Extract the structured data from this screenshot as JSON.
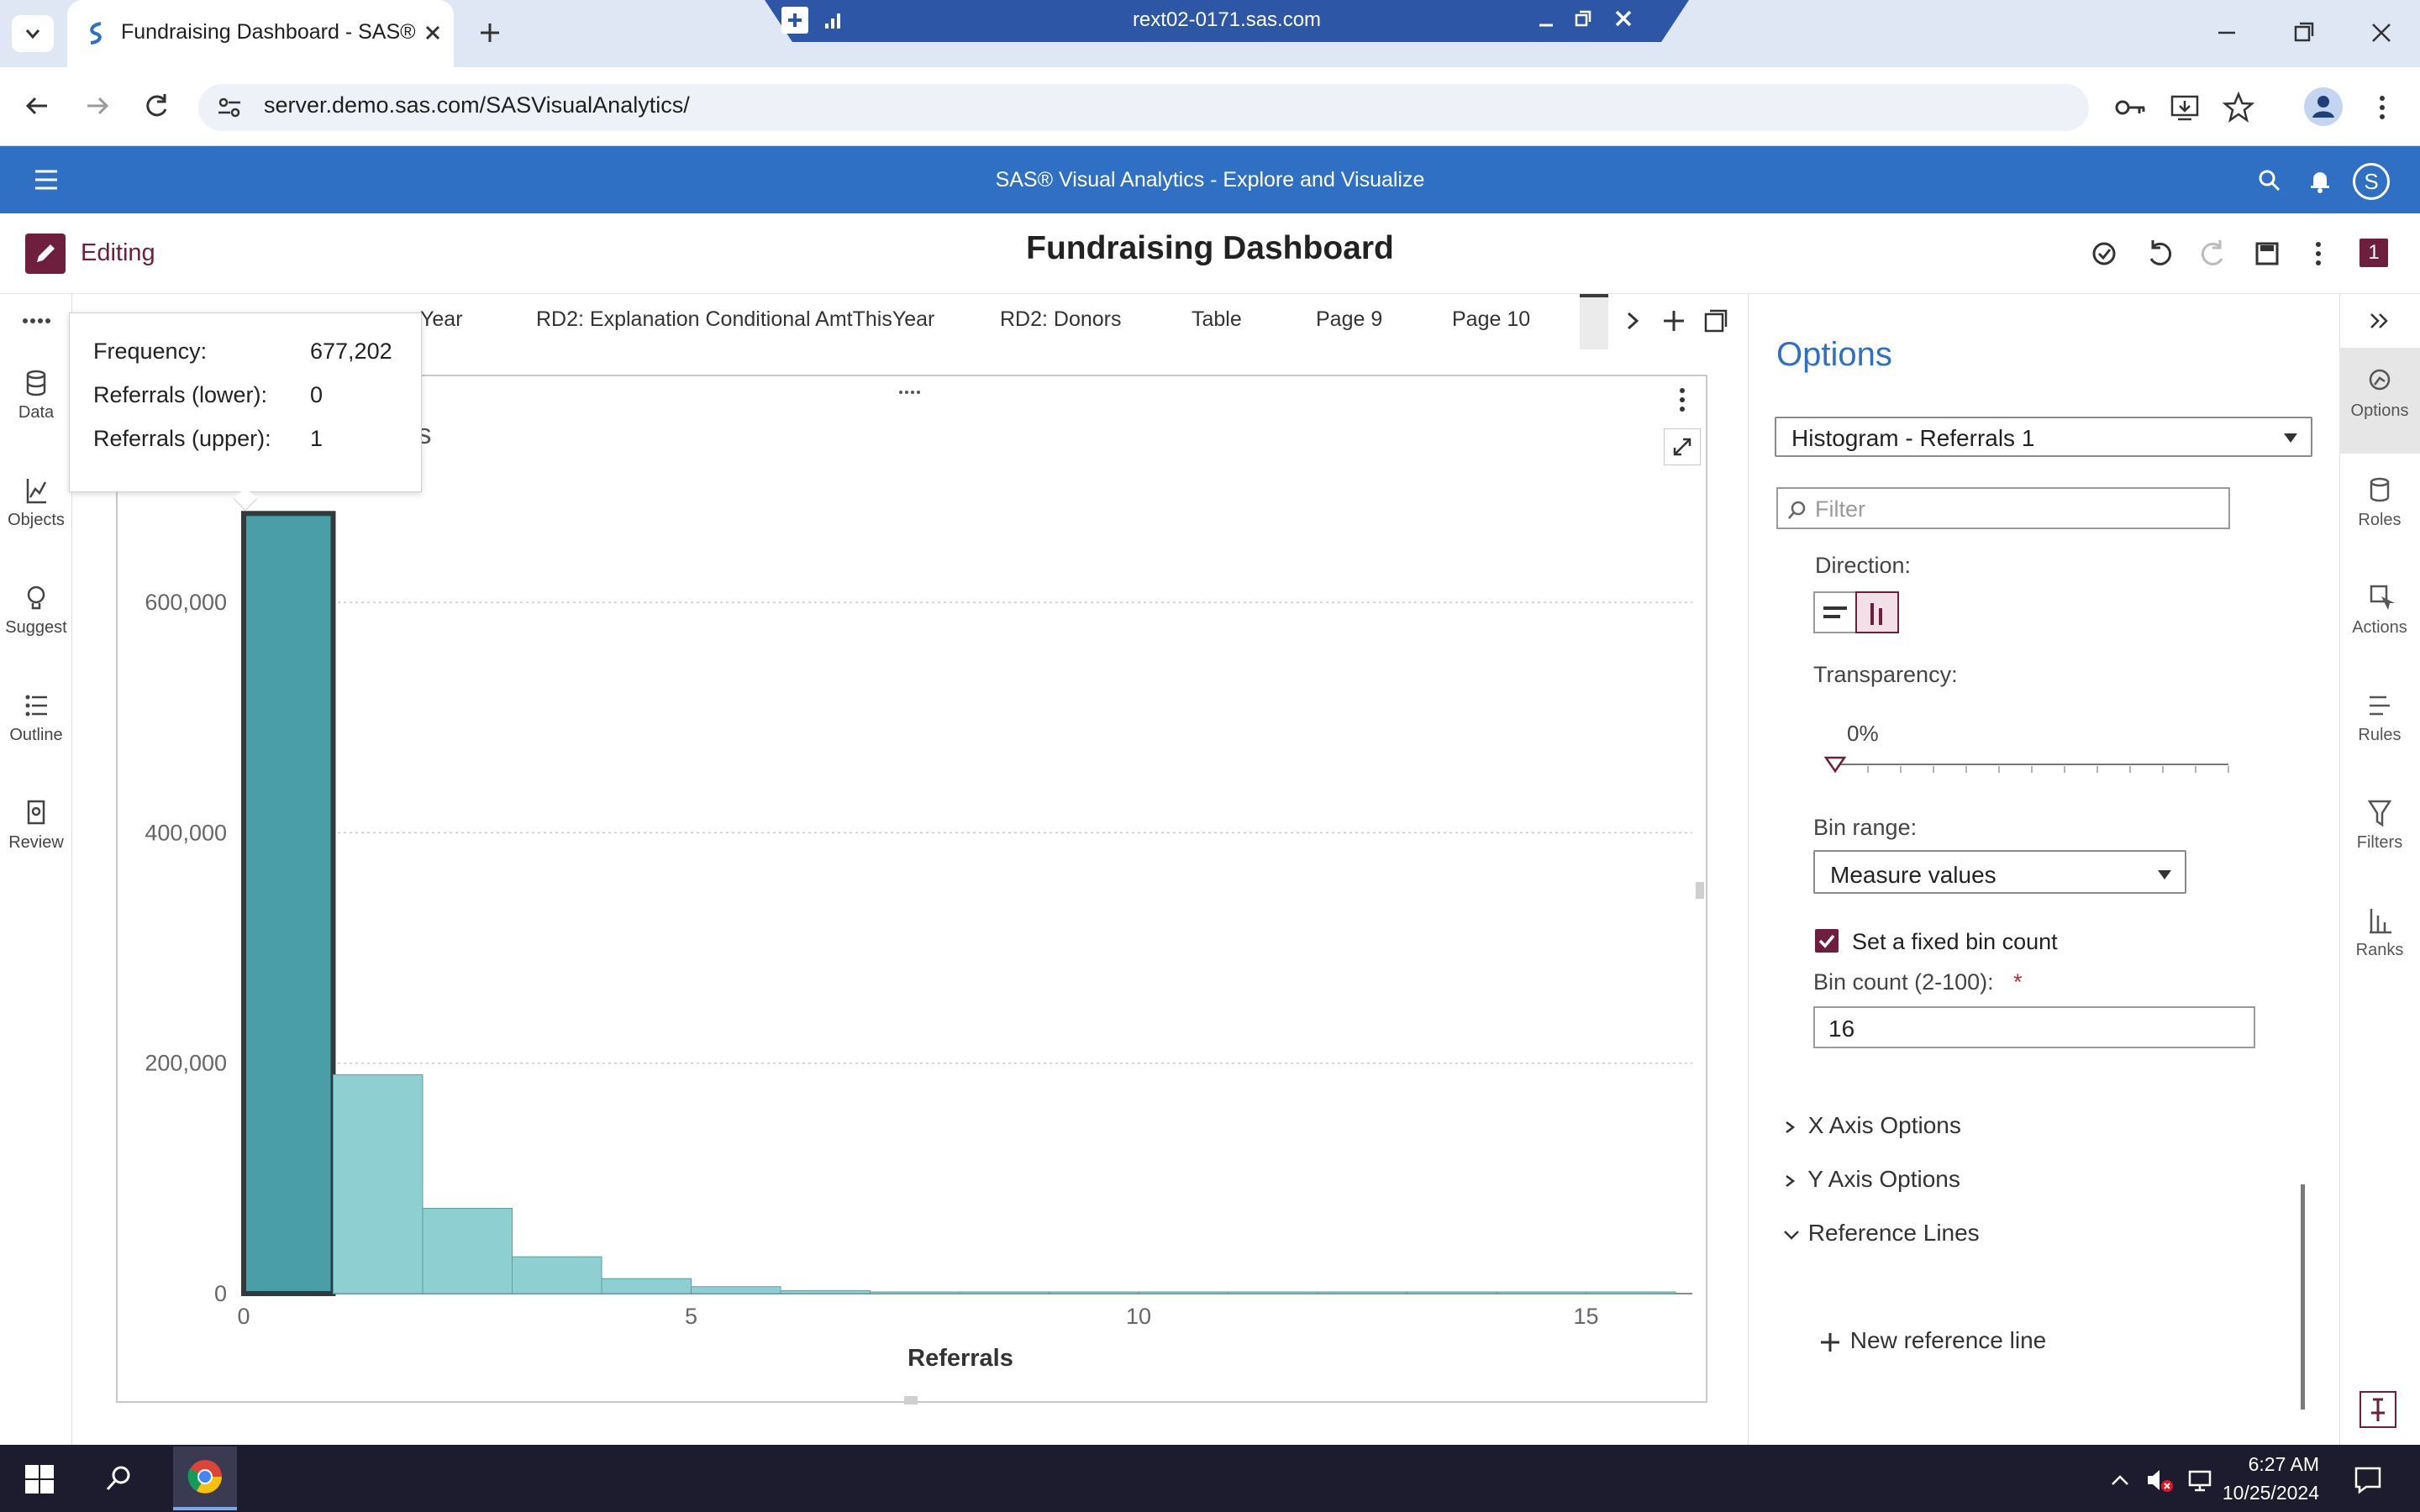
{
  "browser": {
    "tab_title": "Fundraising Dashboard - SAS®",
    "remote_title": "rext02-0171.sas.com",
    "url": "server.demo.sas.com/SASVisualAnalytics/"
  },
  "app": {
    "title": "SAS® Visual Analytics - Explore and Visualize",
    "report_title": "Fundraising Dashboard",
    "mode_label": "Editing",
    "user_initial": "S",
    "page_count_badge": "1"
  },
  "left_rail": [
    {
      "label": "Data",
      "icon": "database-icon"
    },
    {
      "label": "Objects",
      "icon": "chart-line-icon"
    },
    {
      "label": "Suggest",
      "icon": "lightbulb-icon"
    },
    {
      "label": "Outline",
      "icon": "list-icon"
    },
    {
      "label": "Review",
      "icon": "review-icon"
    }
  ],
  "page_tabs": [
    "Year",
    "RD2: Explanation Conditional AmtThisYear",
    "RD2: Donors",
    "Table",
    "Page 9",
    "Page 10"
  ],
  "tooltip": {
    "rows": [
      {
        "label": "Frequency:",
        "value": "677,202"
      },
      {
        "label": "Referrals (lower):",
        "value": "0"
      },
      {
        "label": "Referrals (upper):",
        "value": "1"
      }
    ]
  },
  "chart_title_fragment": "als",
  "chart_data": {
    "type": "bar",
    "title": "",
    "xlabel": "Referrals",
    "ylabel": "",
    "bin_edges": [
      0,
      1,
      2,
      3,
      4,
      5,
      6,
      7,
      8,
      9,
      10,
      11,
      12,
      13,
      14,
      15,
      16
    ],
    "values": [
      677202,
      190000,
      74000,
      32000,
      13000,
      6000,
      2500,
      1000,
      500,
      300,
      200,
      100,
      80,
      50,
      30,
      20
    ],
    "selected_bin": 0,
    "ylim": [
      0,
      700000
    ],
    "yticks": [
      0,
      200000,
      400000,
      600000
    ],
    "ytick_labels": [
      "0",
      "200,000",
      "400,000",
      "600,000"
    ],
    "xticks": [
      0,
      5,
      10,
      15
    ],
    "xtick_labels": [
      "0",
      "5",
      "10",
      "15"
    ],
    "grid": true,
    "colors": {
      "bar": "#8ecfd1",
      "selected": "#4a9ea8",
      "selected_border": "#2f3b3c"
    }
  },
  "options": {
    "header": "Options",
    "object_select": "Histogram - Referrals 1",
    "filter_placeholder": "Filter",
    "direction_label": "Direction:",
    "transparency_label": "Transparency:",
    "transparency_value": "0%",
    "transparency_fraction": 0,
    "bin_range_label": "Bin range:",
    "bin_range_value": "Measure values",
    "fixed_bin_label": "Set a fixed bin count",
    "fixed_bin_checked": true,
    "bin_count_label": "Bin count (2-100):",
    "bin_count_required": "*",
    "bin_count_value": "16",
    "sections": [
      "X Axis Options",
      "Y Axis Options",
      "Reference Lines"
    ],
    "new_reference_line": "New reference line"
  },
  "right_rail": [
    {
      "label": "Options",
      "icon": "options-icon"
    },
    {
      "label": "Roles",
      "icon": "roles-icon"
    },
    {
      "label": "Actions",
      "icon": "actions-icon"
    },
    {
      "label": "Rules",
      "icon": "rules-icon"
    },
    {
      "label": "Filters",
      "icon": "filter-icon"
    },
    {
      "label": "Ranks",
      "icon": "ranks-icon"
    }
  ],
  "taskbar": {
    "time": "6:27 AM",
    "date": "10/25/2024"
  },
  "colors": {
    "sas_blue": "#2f70c4",
    "accent_maroon": "#6d1f3d",
    "options_blue": "#2f70c4"
  }
}
